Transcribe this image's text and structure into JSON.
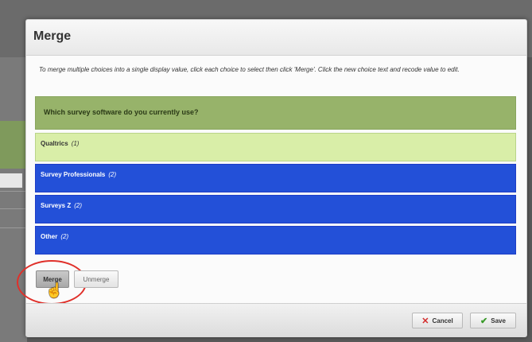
{
  "dialog": {
    "title": "Merge",
    "instructions": "To merge multiple choices into a single display value, click each choice to select then click 'Merge'. Click the new choice text and recode value to edit.",
    "question": "Which survey software do you currently use?",
    "choices": [
      {
        "label": "Qualtrics",
        "count": "(1)",
        "selected": true
      },
      {
        "label": "Survey Professionals",
        "count": "(2)",
        "selected": false
      },
      {
        "label": "Surveys Z",
        "count": "(2)",
        "selected": false
      },
      {
        "label": "Other",
        "count": "(2)",
        "selected": false
      }
    ],
    "merge_label": "Merge",
    "unmerge_label": "Unmerge",
    "cancel_label": "Cancel",
    "save_label": "Save"
  },
  "icons": {
    "cancel": "x-icon",
    "save": "check-icon",
    "cursor": "hand-pointer-icon"
  },
  "colors": {
    "question_bar": "#97b36a",
    "selected_choice": "#d9eea8",
    "unselected_choice": "#2350d8",
    "highlight_ring": "#e0302a"
  }
}
